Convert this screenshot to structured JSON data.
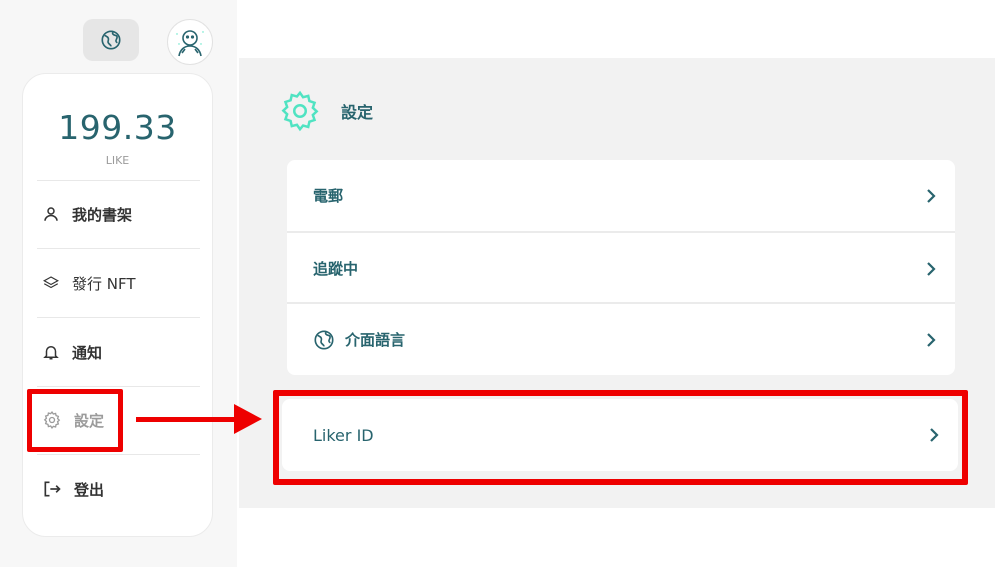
{
  "header": {
    "language_icon": "globe-icon",
    "avatar_icon": "user-avatar-icon"
  },
  "wallet": {
    "balance": "199.33",
    "unit": "LIKE"
  },
  "sidebar": {
    "items": [
      {
        "label": "我的書架",
        "icon": "person-icon"
      },
      {
        "label": "發行 NFT",
        "icon": "layers-icon"
      },
      {
        "label": "通知",
        "icon": "bell-icon"
      },
      {
        "label": "設定",
        "icon": "gear-icon",
        "active": true
      },
      {
        "label": "登出",
        "icon": "logout-icon"
      }
    ]
  },
  "settings": {
    "title": "設定",
    "rows": [
      {
        "label": "電郵"
      },
      {
        "label": "追蹤中"
      },
      {
        "label": "介面語言",
        "icon": "globe-icon"
      }
    ],
    "liker_id": {
      "label": "Liker ID"
    }
  },
  "colors": {
    "brand_teal": "#28646e",
    "accent_mint": "#50e3c2",
    "annotation_red": "#ee0000"
  }
}
